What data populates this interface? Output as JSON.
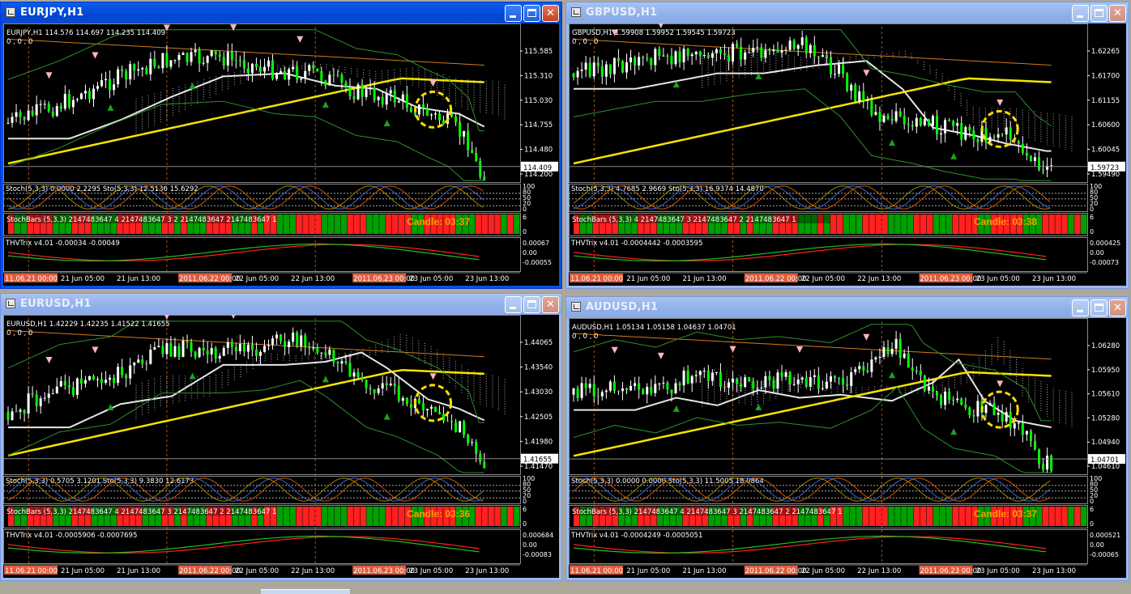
{
  "windows": [
    {
      "title": "EURJPY,H1",
      "active": true,
      "info": {
        "line1": "EURJPY,H1  114.576 114.697 114.235 114.409",
        "line2": "0 , 0 , 0"
      },
      "price_axis": [
        "115.585",
        "115.310",
        "115.030",
        "114.755",
        "114.480",
        "114.200"
      ],
      "current_price": "114.409",
      "stoch_label": "Stoch(5,3,3) 0.0000 2.2295  Sto(5,3,3) 12.5136 15.6292",
      "stoch_scale": [
        "100",
        "80",
        "50",
        "20",
        "0"
      ],
      "stochbars_label": "StochBars (5,3,3) 2147483647 4 2147483647 3 2 2147483647 2147483647 1",
      "stochbars_scale": [
        "6",
        "0"
      ],
      "candle_timer": "Candle:  03:37",
      "thv_label": "THVTrix v4.01 -0.00034 -0.00049",
      "thv_scale": [
        "0.00067",
        "0.00",
        "-0.00055"
      ],
      "time_axis": [
        {
          "text": "11.06.21 00:00",
          "hl": true
        },
        {
          "text": "21 Jun 05:00",
          "hl": false
        },
        {
          "text": "21 Jun 13:00",
          "hl": false
        },
        {
          "text": "2011.06.22 00:00",
          "hl": true
        },
        {
          "text": "22 Jun 05:00",
          "hl": false
        },
        {
          "text": "22 Jun 13:00",
          "hl": false
        },
        {
          "text": "2011.06.23 00:00",
          "hl": true
        },
        {
          "text": "23 Jun 05:00",
          "hl": false
        },
        {
          "text": "23 Jun 13:00",
          "hl": false
        }
      ]
    },
    {
      "title": "GBPUSD,H1",
      "active": false,
      "info": {
        "line1": "GBPUSD,H1  1.59908 1.59952 1.59545 1.59723",
        "line2": "0 , 0 , 0"
      },
      "price_axis": [
        "1.62265",
        "1.61700",
        "1.61155",
        "1.60600",
        "1.60045",
        "1.59490"
      ],
      "current_price": "1.59723",
      "stoch_label": "Stoch(5,3,3) 4.7685 2.9669  Sto(5,3,3) 16.9374 14.4870",
      "stoch_scale": [
        "100",
        "80",
        "50",
        "20",
        "0"
      ],
      "stochbars_label": "StochBars (5,3,3) 4 2147483647 3 2147483647 2 2147483647 1",
      "stochbars_scale": [
        "6",
        "0"
      ],
      "candle_timer": "Candle:  03:38",
      "thv_label": "THVTrix v4.01 -0.0004442 -0.0003595",
      "thv_scale": [
        "0.000425",
        "0.00",
        "-0.00073"
      ],
      "time_axis": [
        {
          "text": "11.06.21 00:00",
          "hl": true
        },
        {
          "text": "21 Jun 05:00",
          "hl": false
        },
        {
          "text": "21 Jun 13:00",
          "hl": false
        },
        {
          "text": "2011.06.22 00:00",
          "hl": true
        },
        {
          "text": "22 Jun 05:00",
          "hl": false
        },
        {
          "text": "22 Jun 13:00",
          "hl": false
        },
        {
          "text": "2011.06.23 00:00",
          "hl": true
        },
        {
          "text": "23 Jun 05:00",
          "hl": false
        },
        {
          "text": "23 Jun 13:00",
          "hl": false
        }
      ]
    },
    {
      "title": "EURUSD,H1",
      "active": false,
      "info": {
        "line1": "EURUSD,H1  1.42229 1.42235 1.41522 1.41655",
        "line2": "0 , 0 , 0"
      },
      "price_axis": [
        "1.44065",
        "1.43540",
        "1.43030",
        "1.42505",
        "1.41980",
        "1.41470"
      ],
      "current_price": "1.41655",
      "stoch_label": "Stoch(5,3,3) 0.5705 3.1201  Sto(5,3,3) 9.3830 12.6173",
      "stoch_scale": [
        "100",
        "80",
        "50",
        "20",
        "0"
      ],
      "stochbars_label": "StochBars (5,3,3) 2147483647 4 2147483647 3 2147483647 2 2147483647 1",
      "stochbars_scale": [
        "6",
        "0"
      ],
      "candle_timer": "Candle:  03:36",
      "thv_label": "THVTrix v4.01 -0.0005906 -0.0007695",
      "thv_scale": [
        "0.000684",
        "0.00",
        "-0.00083"
      ],
      "time_axis": [
        {
          "text": "11.06.21 00:00",
          "hl": true
        },
        {
          "text": "21 Jun 05:00",
          "hl": false
        },
        {
          "text": "21 Jun 13:00",
          "hl": false
        },
        {
          "text": "2011.06.22 00:00",
          "hl": true
        },
        {
          "text": "22 Jun 05:00",
          "hl": false
        },
        {
          "text": "22 Jun 13:00",
          "hl": false
        },
        {
          "text": "2011.06.23 00:00",
          "hl": true
        },
        {
          "text": "23 Jun 05:00",
          "hl": false
        },
        {
          "text": "23 Jun 13:00",
          "hl": false
        }
      ]
    },
    {
      "title": "AUDUSD,H1",
      "active": false,
      "info": {
        "line1": "AUDUSD,H1  1.05134 1.05158 1.04637 1.04701",
        "line2": "0 , 0 , 0"
      },
      "price_axis": [
        "1.06280",
        "1.05950",
        "1.05610",
        "1.05280",
        "1.04940",
        "1.04610"
      ],
      "current_price": "1.04701",
      "stoch_label": "Stoch(5,3,3) 0.0000 0.0000  Sto(5,3,3) 11.5005 18.0864",
      "stoch_scale": [
        "100",
        "80",
        "50",
        "20",
        "0"
      ],
      "stochbars_label": "StochBars (5,3,3) 2147483647 4 2147483647 3 2147483647 2 2147483647 1",
      "stochbars_scale": [
        "6",
        "0"
      ],
      "candle_timer": "Candle:  03:37",
      "thv_label": "THVTrix v4.01 -0.0004249 -0.0005051",
      "thv_scale": [
        "0.000521",
        "0.00",
        "-0.00065"
      ],
      "time_axis": [
        {
          "text": "11.06.21 00:00",
          "hl": true
        },
        {
          "text": "21 Jun 05:00",
          "hl": false
        },
        {
          "text": "21 Jun 13:00",
          "hl": false
        },
        {
          "text": "2011.06.22 00:00",
          "hl": true
        },
        {
          "text": "22 Jun 05:00",
          "hl": false
        },
        {
          "text": "22 Jun 13:00",
          "hl": false
        },
        {
          "text": "2011.06.23 00:00",
          "hl": true
        },
        {
          "text": "23 Jun 05:00",
          "hl": false
        },
        {
          "text": "23 Jun 13:00",
          "hl": false
        }
      ]
    }
  ],
  "colors": {
    "bull_candle": "#ffffff",
    "bear_candle": "#00ff00",
    "ma_white": "#e6e6e6",
    "ma_yellow": "#f5e400",
    "ma_orange": "#d27a1e",
    "bollinger": "#2d8f2d",
    "session_line": "#d2691e",
    "stoch_red": "#ff2020",
    "stoch_green": "#00a000",
    "candle_timer": "#ff9c00",
    "highlight_circle": "#ffdd00"
  }
}
